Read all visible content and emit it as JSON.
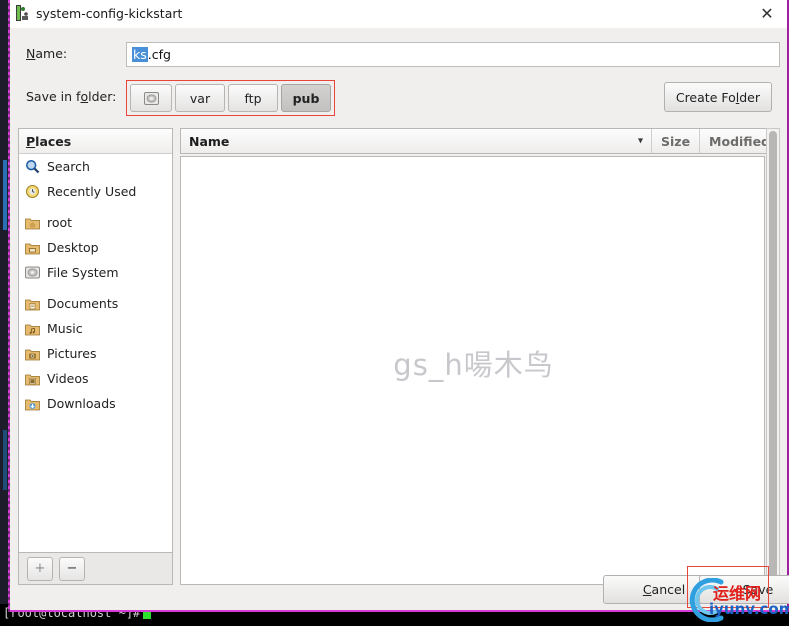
{
  "window": {
    "title": "system-config-kickstart",
    "icon": "app-icon",
    "close_label": "✕"
  },
  "name_row": {
    "label_prefix": "N",
    "label_rest": "ame:",
    "value_selected": "ks",
    "value_rest": ".cfg"
  },
  "folder_row": {
    "label_prefix": "Save in f",
    "label_mnemonic": "o",
    "label_rest": "lder:",
    "crumbs": [
      {
        "label": "",
        "icon": "filesystem-icon",
        "active": false
      },
      {
        "label": "var",
        "icon": "",
        "active": false
      },
      {
        "label": "ftp",
        "icon": "",
        "active": false
      },
      {
        "label": "pub",
        "icon": "",
        "active": true
      }
    ],
    "create_folder_prefix": "Create Fo",
    "create_folder_mnemonic": "l",
    "create_folder_rest": "der"
  },
  "places": {
    "header_mnemonic": "P",
    "header_rest": "laces",
    "items": [
      {
        "label": "Search",
        "icon": "search-icon"
      },
      {
        "label": "Recently Used",
        "icon": "recent-clock-icon"
      },
      {
        "label": "root",
        "icon": "home-folder-icon"
      },
      {
        "label": "Desktop",
        "icon": "desktop-folder-icon"
      },
      {
        "label": "File System",
        "icon": "drive-icon"
      },
      {
        "label": "Documents",
        "icon": "documents-folder-icon"
      },
      {
        "label": "Music",
        "icon": "music-folder-icon"
      },
      {
        "label": "Pictures",
        "icon": "pictures-folder-icon"
      },
      {
        "label": "Videos",
        "icon": "videos-folder-icon"
      },
      {
        "label": "Downloads",
        "icon": "downloads-folder-icon"
      }
    ],
    "add_label": "+",
    "remove_label": "−"
  },
  "file_list": {
    "columns": [
      {
        "label": "Name"
      },
      {
        "label": "Size"
      },
      {
        "label": "Modified"
      }
    ],
    "sort_indicator": "▾",
    "rows": [],
    "watermark": "gs_h啺木鸟"
  },
  "footer": {
    "cancel_prefix": "C",
    "cancel_rest": "ancel",
    "save_label": "Save"
  },
  "terminal": {
    "prompt": "[root@localhost ~]#"
  },
  "branding": {
    "cn_text": "运维网",
    "url_text": "iyunv.com"
  },
  "colors": {
    "window_border": "#d63bd6",
    "annotation": "#e8453c",
    "selection": "#4a90d9",
    "brand_red": "#e0201b",
    "brand_blue": "#1b63c4"
  }
}
